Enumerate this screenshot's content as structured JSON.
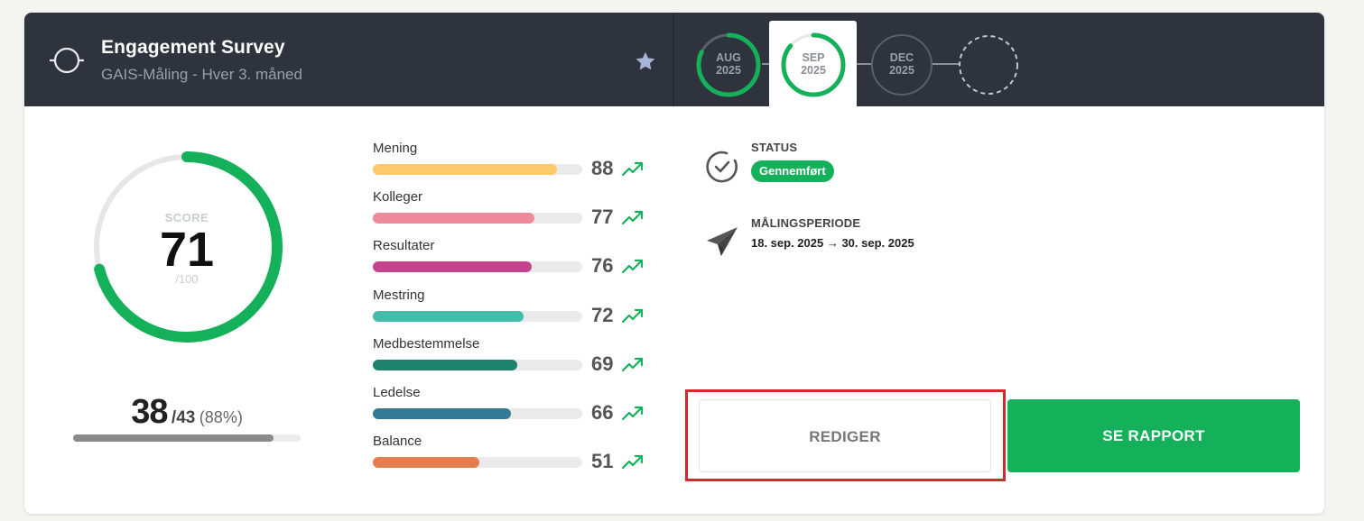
{
  "header": {
    "title": "Engagement Survey",
    "subtitle": "GAIS-Måling - Hver 3. måned",
    "icons": {
      "survey": "target-circle-icon",
      "favorite": "star-icon"
    }
  },
  "timeline": [
    {
      "month": "AUG",
      "year": "2025",
      "progress": 0.82,
      "active": false
    },
    {
      "month": "SEP",
      "year": "2025",
      "progress": 0.86,
      "active": true
    },
    {
      "month": "DEC",
      "year": "2025",
      "progress": 0,
      "active": false
    },
    {
      "month": "",
      "year": "",
      "progress": 0,
      "active": false,
      "future": true
    }
  ],
  "score": {
    "caption": "SCORE",
    "value": "71",
    "max": "/100",
    "fraction": 0.71,
    "color": "#15b05a"
  },
  "responses": {
    "count": "38",
    "total": "/43",
    "percent": "(88%)",
    "fraction": 0.88
  },
  "dimensions": [
    {
      "name": "Mening",
      "value": "88",
      "color": "#fdc96b",
      "trend": "up"
    },
    {
      "name": "Kolleger",
      "value": "77",
      "color": "#ee8a9c",
      "trend": "up"
    },
    {
      "name": "Resultater",
      "value": "76",
      "color": "#c3448c",
      "trend": "up"
    },
    {
      "name": "Mestring",
      "value": "72",
      "color": "#43bcac",
      "trend": "up"
    },
    {
      "name": "Medbestemmelse",
      "value": "69",
      "color": "#1f826c",
      "trend": "up"
    },
    {
      "name": "Ledelse",
      "value": "66",
      "color": "#327a94",
      "trend": "up"
    },
    {
      "name": "Balance",
      "value": "51",
      "color": "#e57d4e",
      "trend": "up"
    }
  ],
  "status": {
    "label": "STATUS",
    "value": "Gennemført",
    "icon": "check-circle-icon"
  },
  "period": {
    "label": "MÅLINGSPERIODE",
    "range": "18. sep. 2025 → 30. sep. 2025",
    "icon": "paper-plane-icon"
  },
  "actions": {
    "edit": "REDIGER",
    "report": "SE RAPPORT"
  },
  "colors": {
    "header": "#2e333d",
    "accent": "#15b05a",
    "trend": "#15b05a"
  }
}
